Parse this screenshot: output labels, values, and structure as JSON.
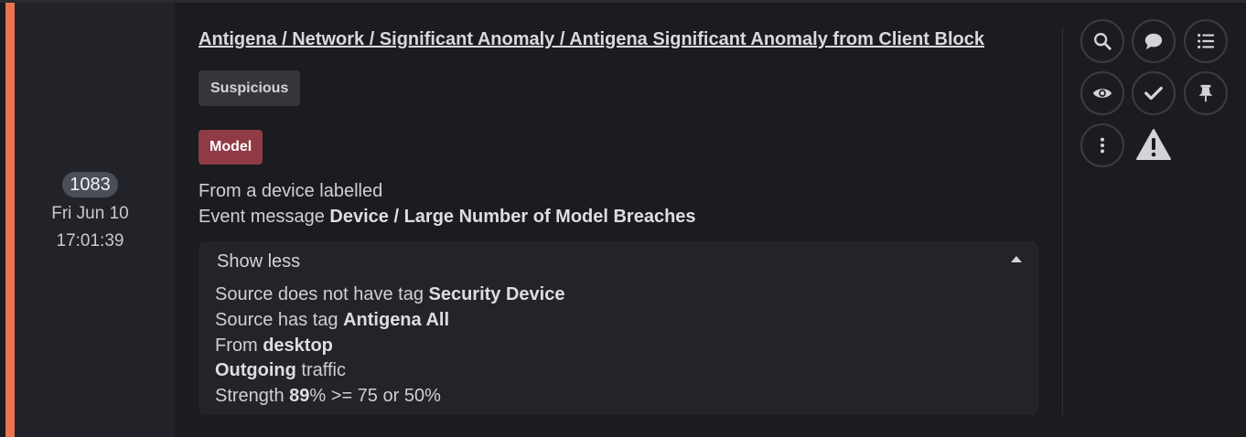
{
  "breach": {
    "count": "1083",
    "date": "Fri Jun 10",
    "time": "17:01:39",
    "title": "Antigena / Network / Significant Anomaly / Antigena Significant Anomaly from Client Block",
    "tag_label": "Suspicious",
    "model_label": "Model",
    "device_line": "From a device labelled",
    "event_prefix": "Event message ",
    "event_value": "Device / Large Number of Model Breaches"
  },
  "details": {
    "toggle_label": "Show less",
    "lines": [
      {
        "prefix": "Source does not have tag ",
        "bold": "Security Device",
        "suffix": ""
      },
      {
        "prefix": "Source has tag ",
        "bold": "Antigena All",
        "suffix": ""
      },
      {
        "prefix": "From ",
        "bold": "desktop",
        "suffix": ""
      },
      {
        "prefix": "",
        "bold": "Outgoing",
        "suffix": " traffic"
      },
      {
        "prefix": "Strength ",
        "bold": "89",
        "suffix": "% >= 75 or 50%"
      }
    ]
  },
  "actions": {
    "icons": [
      "search-icon",
      "comment-icon",
      "list-icon",
      "eye-icon",
      "check-icon",
      "pin-icon",
      "more-icon",
      "warning-icon"
    ]
  },
  "colors": {
    "accent": "#e87450",
    "model_pill": "#8f3a45",
    "background": "#1b1c20"
  }
}
